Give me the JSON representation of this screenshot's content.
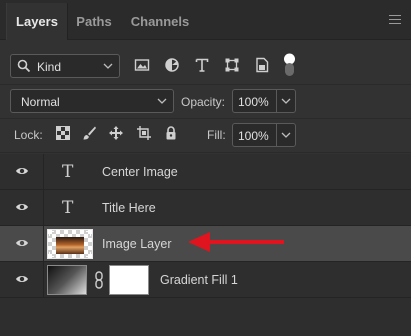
{
  "tabs": [
    {
      "label": "Layers",
      "active": true
    },
    {
      "label": "Paths",
      "active": false
    },
    {
      "label": "Channels",
      "active": false
    }
  ],
  "filter": {
    "kind_value": "Kind",
    "icons": [
      "image-filter-icon",
      "adjustment-filter-icon",
      "type-filter-icon",
      "shape-filter-icon",
      "smart-object-filter-icon",
      "filter-toggle"
    ]
  },
  "blend": {
    "mode": "Normal",
    "opacity_label": "Opacity:",
    "opacity_value": "100%"
  },
  "lock": {
    "label": "Lock:",
    "icons": [
      "lock-transparent-pixels-icon",
      "lock-image-pixels-icon",
      "lock-position-icon",
      "lock-artboard-icon",
      "lock-all-icon"
    ],
    "fill_label": "Fill:",
    "fill_value": "100%"
  },
  "layers": [
    {
      "name": "Center Image",
      "type": "text",
      "visible": true,
      "selected": false
    },
    {
      "name": "Title Here",
      "type": "text",
      "visible": true,
      "selected": false
    },
    {
      "name": "Image Layer",
      "type": "image",
      "visible": true,
      "selected": true
    },
    {
      "name": "Gradient Fill 1",
      "type": "fill",
      "visible": true,
      "selected": false
    }
  ],
  "colors": {
    "panel_bg": "#323232",
    "selected_row": "#4a4a4a",
    "arrow": "#e0141e"
  }
}
